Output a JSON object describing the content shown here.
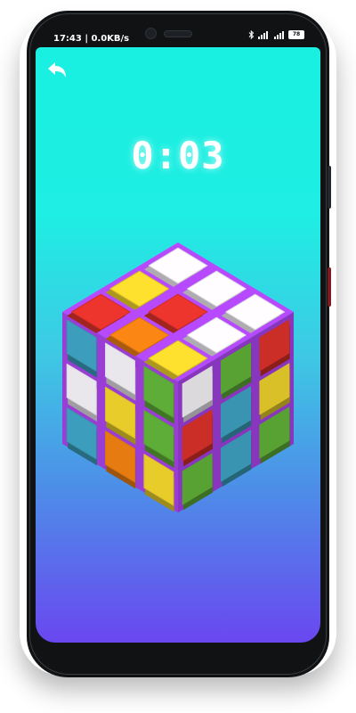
{
  "status_bar": {
    "time_speed": "17:43 | 0.0KB/s",
    "battery_level": "78",
    "icons": [
      "bluetooth-icon",
      "signal-icon",
      "signal-icon",
      "battery-icon"
    ]
  },
  "toolbar": {
    "back_icon": "undo-arrow-icon"
  },
  "game": {
    "timer": "0:03"
  },
  "colors": {
    "background_top": "#19f0e1",
    "background_bottom": "#6a47f0",
    "cube_body": "#a642e8",
    "white": "#f4f1f6",
    "yellow": "#f2d52c",
    "red": "#e2322b",
    "orange": "#f08012",
    "blue": "#3ea4c4",
    "green": "#62b43a"
  },
  "cube": {
    "top_face": [
      [
        "white",
        "white",
        "white"
      ],
      [
        "yellow",
        "red",
        "white"
      ],
      [
        "red",
        "orange",
        "yellow"
      ]
    ],
    "left_face": [
      [
        "blue",
        "white",
        "green"
      ],
      [
        "white",
        "yellow",
        "green"
      ],
      [
        "blue",
        "orange",
        "yellow"
      ]
    ],
    "right_face": [
      [
        "white",
        "green",
        "red"
      ],
      [
        "red",
        "blue",
        "yellow"
      ],
      [
        "green",
        "blue",
        "green"
      ]
    ]
  }
}
